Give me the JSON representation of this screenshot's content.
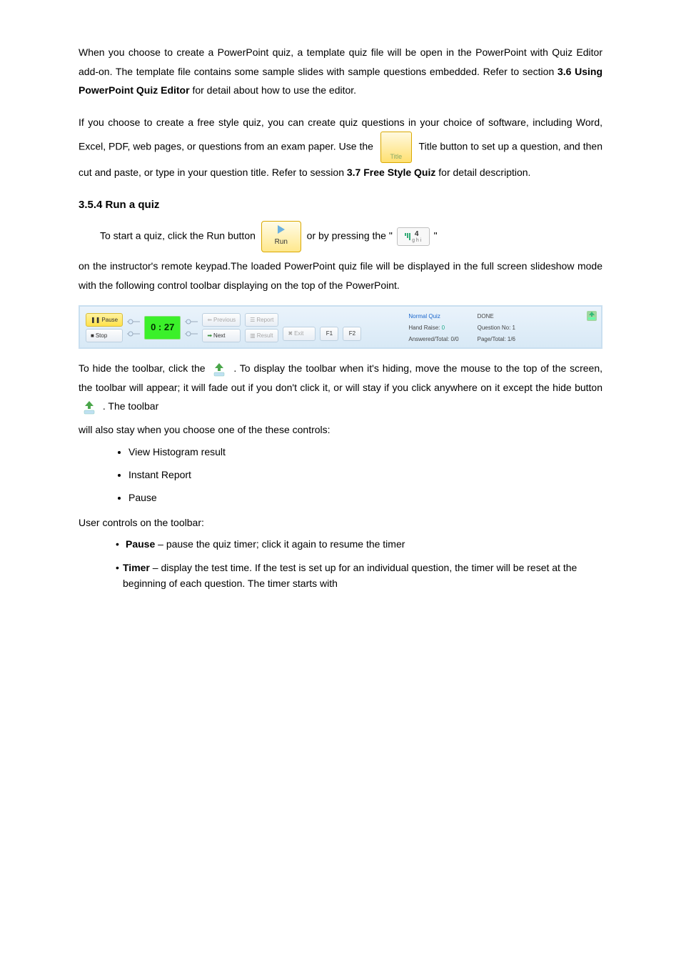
{
  "p1_a": "When you choose to create a PowerPoint quiz, a template quiz file will be open in the PowerPoint with Quiz Editor add-on. The template file contains some sample slides with sample questions embedded. Refer to section",
  "p1_b": "3.6 Using PowerPoint Quiz Editor",
  "p1_c": "for detail about how to use the editor.",
  "p2_a": "If you choose to create a free style quiz, you can create quiz questions in your choice of software, including Word, Excel, PDF, web pages, or questions from an exam paper. Use the",
  "p2_b": "Title button to set up a question, and then cut and paste, or type in your question title. Refer to session",
  "p2_c": "3.7 Free Style Quiz",
  "p2_d": "for detail description.",
  "title_btn_label": "Title",
  "h_354": "3.5.4    Run a quiz",
  "p3_a": "To start a quiz, click the Run button",
  "p3_b": "or by pressing the \"",
  "p3_c": "\"",
  "run_btn_label": "Run",
  "key_num": "4",
  "key_sub": "g h i",
  "p4": "on the instructor's remote keypad.The loaded PowerPoint quiz file will be displayed in the full screen slideshow mode with the following control toolbar displaying on the top of the PowerPoint.",
  "toolbar": {
    "pause": "Pause",
    "stop": "Stop",
    "timer": "0 : 27",
    "previous": "Previous",
    "next": "Next",
    "report": "Report",
    "result": "Result",
    "exit": "Exit",
    "f1": "F1",
    "f2": "F2",
    "normal": "Normal Quiz",
    "done": "DONE",
    "hand": "Hand Raise:",
    "hand_v": "0",
    "qno": "Question No: 1",
    "ans": "Answered/Total: 0/0",
    "page": "Page/Total: 1/6"
  },
  "p5_a": "To hide the toolbar, click the",
  "p5_b": ". To display the toolbar when it's hiding, move the mouse to the top of the screen, the toolbar will appear; it will fade out if you don't click it, or will stay if you click anywhere on it except the hide button",
  "p5_c": ". The toolbar",
  "p6": "will also stay when you choose one of the these controls:",
  "bul1": "View Histogram result",
  "bul2": "Instant Report",
  "bul3": "Pause",
  "p7": "User controls on the toolbar:",
  "d1_term": "Pause",
  "d1_body": " – pause the quiz timer; click it again to resume the timer",
  "d2_term": "Timer",
  "d2_body": " – display the test time. If the test is set up for an individual question, the timer will be reset at the beginning of each question. The timer starts with"
}
